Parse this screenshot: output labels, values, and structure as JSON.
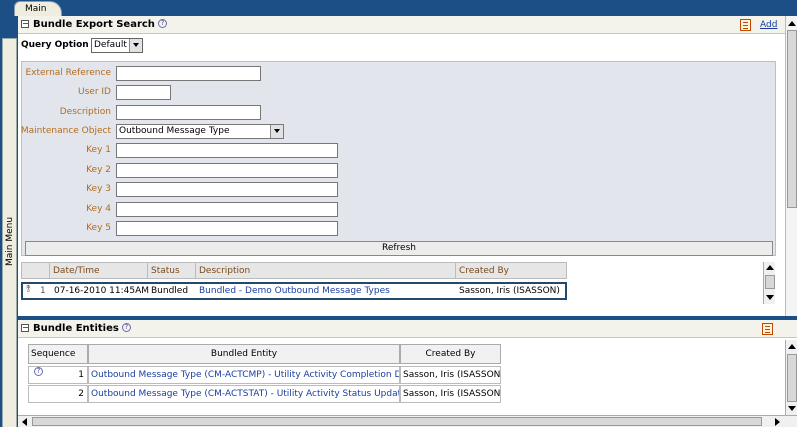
{
  "tabs": {
    "main": "Main"
  },
  "leftbar": {
    "label": "Main Menu"
  },
  "section1": {
    "title": "Bundle Export Search",
    "add_label": "Add",
    "query_option_label": "Query Option",
    "query_option_value": "Default",
    "fields": {
      "external_reference": {
        "label": "External Reference",
        "value": ""
      },
      "user_id": {
        "label": "User ID",
        "value": ""
      },
      "description": {
        "label": "Description",
        "value": ""
      },
      "maintenance_object": {
        "label": "Maintenance Object",
        "value": "Outbound Message Type"
      },
      "key1": {
        "label": "Key 1",
        "value": ""
      },
      "key2": {
        "label": "Key 2",
        "value": ""
      },
      "key3": {
        "label": "Key 3",
        "value": ""
      },
      "key4": {
        "label": "Key 4",
        "value": ""
      },
      "key5": {
        "label": "Key 5",
        "value": ""
      }
    },
    "refresh_label": "Refresh",
    "results": {
      "columns": {
        "datetime": "Date/Time",
        "status": "Status",
        "description": "Description",
        "created_by": "Created By"
      },
      "rows": [
        {
          "index": "1",
          "datetime": "07-16-2010 11:45AM",
          "status": "Bundled",
          "description": "Bundled - Demo Outbound Message Types",
          "created_by": "Sasson, Iris (ISASSON)"
        }
      ]
    }
  },
  "section2": {
    "title": "Bundle Entities",
    "columns": {
      "sequence": "Sequence",
      "entity": "Bundled Entity",
      "created_by": "Created By"
    },
    "rows": [
      {
        "sequence": "1",
        "entity": "Outbound Message Type (CM-ACTCMP) - Utility Activity Completion Details",
        "created_by": "Sasson, Iris (ISASSON)"
      },
      {
        "sequence": "2",
        "entity": "Outbound Message Type (CM-ACTSTAT) - Utility Activity Status Update",
        "created_by": "Sasson, Iris (ISASSON)"
      }
    ]
  },
  "colors": {
    "frame": "#1c4f86",
    "label": "#b36b1e",
    "link": "#1a3ea0",
    "panel": "#e2e6ec"
  }
}
